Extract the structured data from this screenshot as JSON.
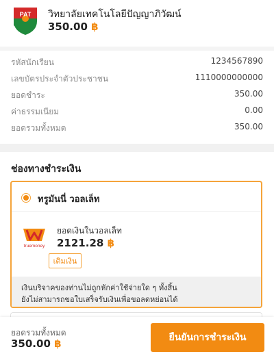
{
  "header": {
    "school_name": "วิทยาลัยเทคโนโลยีปัญญาภิวัฒน์",
    "amount": "350.00",
    "currency_symbol": "฿",
    "logo_letters": "PAT"
  },
  "details": [
    {
      "label": "รหัสนักเรียน",
      "value": "1234567890"
    },
    {
      "label": "เลขบัตรประจำตัวประชาชน",
      "value": "1110000000000"
    },
    {
      "label": "ยอดชำระ",
      "value": "350.00"
    },
    {
      "label": "ค่าธรรมเนียม",
      "value": "0.00"
    },
    {
      "label": "ยอดรวมทั้งหมด",
      "value": "350.00"
    }
  ],
  "payment": {
    "section_title": "ช่องทางชำระเงิน",
    "method_name": "ทรูมันนี่ วอลเล็ท",
    "wallet_logo_text": "truemoney",
    "wallet_label": "ยอดเงินในวอลเล็ท",
    "wallet_amount": "2121.28",
    "topup_label": "เติมเงิน",
    "note_line1": "เงินบริจาคของท่านไม่ถูกหักค่าใช้จ่ายใด ๆ ทั้งสิ้น",
    "note_line2": "ยังไม่สามารถขอใบเสร็จรับเงินเพื่อขอลดหย่อนได้"
  },
  "footer": {
    "total_label": "ยอดรวมทั้งหมด",
    "total_amount": "350.00",
    "confirm_label": "ยืนยันการชำระเงิน"
  },
  "colors": {
    "accent": "#f28b12",
    "logo_red": "#d42a2a",
    "logo_green": "#1f8a3c"
  }
}
